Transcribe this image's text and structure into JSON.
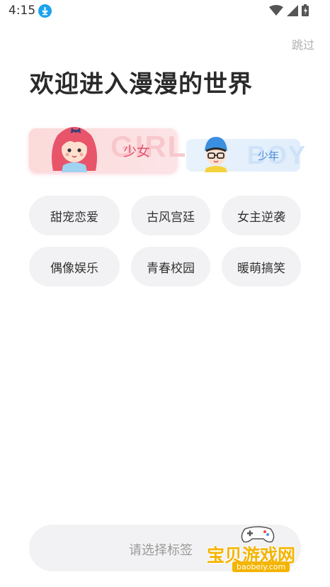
{
  "status_bar": {
    "time": "4:15"
  },
  "skip_label": "跳过",
  "title": "欢迎进入漫漫的世界",
  "gender": {
    "girl": {
      "label": "少女",
      "watermark": "GIRL"
    },
    "boy": {
      "label": "少年",
      "watermark": "BOY"
    }
  },
  "tags": [
    "甜宠恋爱",
    "古风宫廷",
    "女主逆袭",
    "偶像娱乐",
    "青春校园",
    "暖萌搞笑"
  ],
  "bottom": {
    "label": "请选择标签"
  },
  "watermark": {
    "text": "宝贝游戏网",
    "url": "baobeiy.com"
  },
  "colors": {
    "accent_girl": "#e2506a",
    "accent_boy": "#4a8ad6",
    "tag_bg": "#f2f2f4",
    "watermark": "#f4b400"
  }
}
